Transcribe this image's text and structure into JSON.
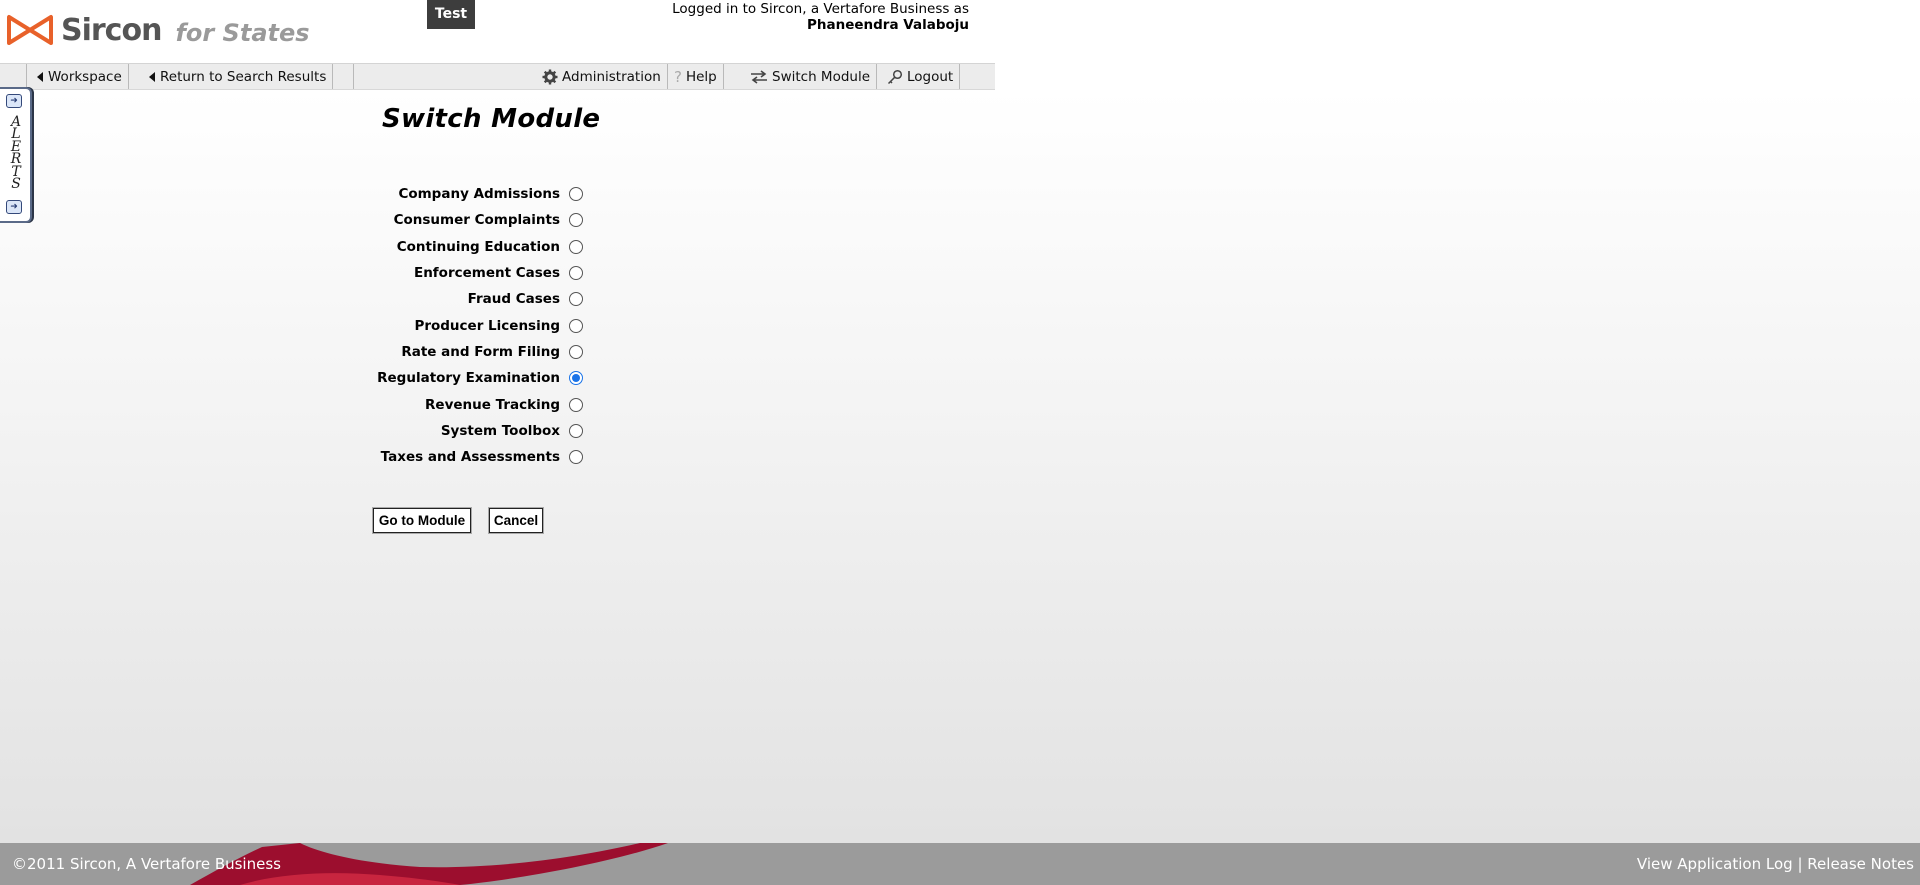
{
  "header": {
    "logo_sircon": "Sircon",
    "logo_for_states": "for States",
    "environment_badge": "Test",
    "login_line": "Logged in to Sircon, a Vertafore Business as",
    "user_name": "Phaneendra Valaboju"
  },
  "nav": {
    "workspace": "Workspace",
    "return_to_search": "Return to Search Results",
    "administration": "Administration",
    "help": "Help",
    "switch_module": "Switch Module",
    "logout": "Logout"
  },
  "alerts": {
    "letters": [
      "A",
      "L",
      "E",
      "R",
      "T",
      "S"
    ]
  },
  "page": {
    "title": "Switch Module"
  },
  "modules": [
    {
      "label": "Company Admissions",
      "selected": false
    },
    {
      "label": "Consumer Complaints",
      "selected": false
    },
    {
      "label": "Continuing Education",
      "selected": false
    },
    {
      "label": "Enforcement Cases",
      "selected": false
    },
    {
      "label": "Fraud Cases",
      "selected": false
    },
    {
      "label": "Producer Licensing",
      "selected": false
    },
    {
      "label": "Rate and Form Filing",
      "selected": false
    },
    {
      "label": "Regulatory Examination",
      "selected": true
    },
    {
      "label": "Revenue Tracking",
      "selected": false
    },
    {
      "label": "System Toolbox",
      "selected": false
    },
    {
      "label": "Taxes and Assessments",
      "selected": false
    }
  ],
  "buttons": {
    "go": "Go to Module",
    "cancel": "Cancel"
  },
  "footer": {
    "copyright": "©2011 Sircon, A Vertafore Business",
    "view_log": "View Application Log",
    "separator": "|",
    "release_notes": "Release Notes"
  },
  "colors": {
    "brand_orange": "#e8612a",
    "footer_gray": "#9b9b9b",
    "footer_red": "#9c0e2e",
    "radio_selected": "#1a73e8"
  }
}
